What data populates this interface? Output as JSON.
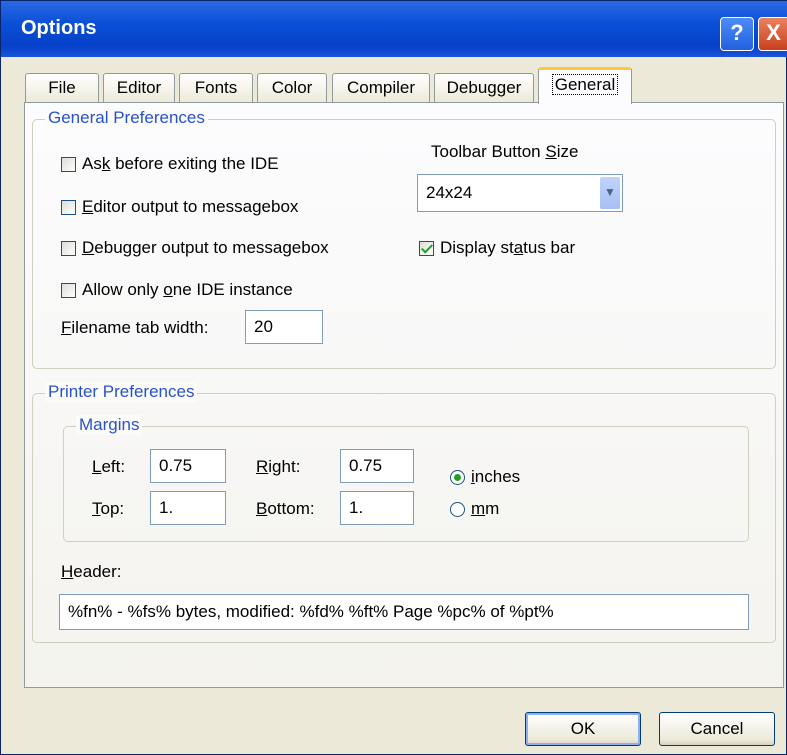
{
  "window": {
    "title": "Options"
  },
  "titlebar": {
    "help_glyph": "?",
    "close_glyph": "X"
  },
  "tabs": [
    {
      "label": "File"
    },
    {
      "label": "Editor"
    },
    {
      "label": "Fonts"
    },
    {
      "label": "Color"
    },
    {
      "label": "Compiler"
    },
    {
      "label": "Debugger"
    },
    {
      "label": "General",
      "active": true
    }
  ],
  "general": {
    "legend": "General Preferences",
    "ask_exit": {
      "pre": "As",
      "u": "k",
      "post": " before exiting the IDE",
      "checked": false
    },
    "editor_output": {
      "pre": "",
      "u": "E",
      "post": "ditor output to messagebox",
      "checked": false
    },
    "debugger_output": {
      "pre": "",
      "u": "D",
      "post": "ebugger output to messagebox",
      "checked": false
    },
    "one_instance": {
      "pre": "Allow only ",
      "u": "o",
      "post": "ne IDE instance",
      "checked": false
    },
    "tab_width": {
      "pre": "",
      "u": "F",
      "post": "ilename tab width:",
      "value": "20"
    },
    "toolbar_size": {
      "pre": "Toolbar Button ",
      "u": "S",
      "post": "ize",
      "value": "24x24"
    },
    "status_bar": {
      "pre": "Display st",
      "u": "a",
      "post": "tus bar",
      "checked": true
    }
  },
  "printer": {
    "legend": "Printer Preferences",
    "margins_legend": "Margins",
    "left": {
      "u": "L",
      "post": "eft:",
      "value": "0.75"
    },
    "right": {
      "u": "R",
      "post": "ight:",
      "value": "0.75"
    },
    "top": {
      "u": "T",
      "post": "op:",
      "value": "1."
    },
    "bottom": {
      "u": "B",
      "post": "ottom:",
      "value": "1."
    },
    "inches": {
      "u": "i",
      "post": "nches",
      "selected": true
    },
    "mm": {
      "u": "m",
      "post": "m",
      "selected": false
    },
    "header": {
      "u": "H",
      "post": "eader:",
      "value": "%fn% - %fs% bytes, modified: %fd% %ft%  Page %pc% of %pt%"
    }
  },
  "buttons": {
    "ok": "OK",
    "cancel": "Cancel"
  }
}
